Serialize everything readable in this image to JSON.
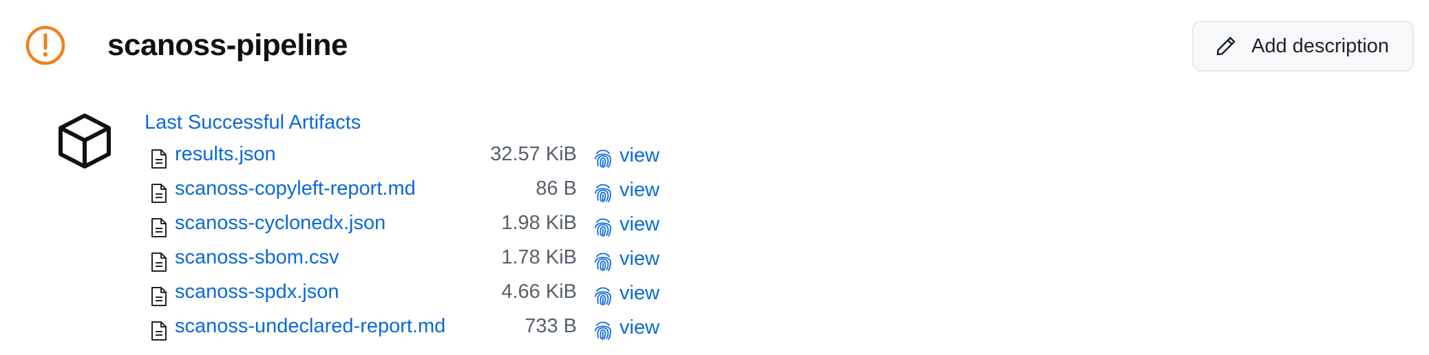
{
  "header": {
    "title": "scanoss-pipeline",
    "status_icon": "warning-circle-icon",
    "status_color": "#f0801c"
  },
  "actions": {
    "add_description_label": "Add description",
    "add_description_icon": "pencil-icon"
  },
  "artifacts": {
    "icon": "package-icon",
    "heading": "Last Successful Artifacts",
    "view_label": "view",
    "view_icon": "fingerprint-icon",
    "file_icon": "file-icon",
    "files": [
      {
        "name": "results.json",
        "size": "32.57 KiB"
      },
      {
        "name": "scanoss-copyleft-report.md",
        "size": "86 B"
      },
      {
        "name": "scanoss-cyclonedx.json",
        "size": "1.98 KiB"
      },
      {
        "name": "scanoss-sbom.csv",
        "size": "1.78 KiB"
      },
      {
        "name": "scanoss-spdx.json",
        "size": "4.66 KiB"
      },
      {
        "name": "scanoss-undeclared-report.md",
        "size": "733 B"
      }
    ]
  },
  "colors": {
    "link": "#0969da",
    "muted": "#57606a",
    "warning": "#f0801c"
  }
}
